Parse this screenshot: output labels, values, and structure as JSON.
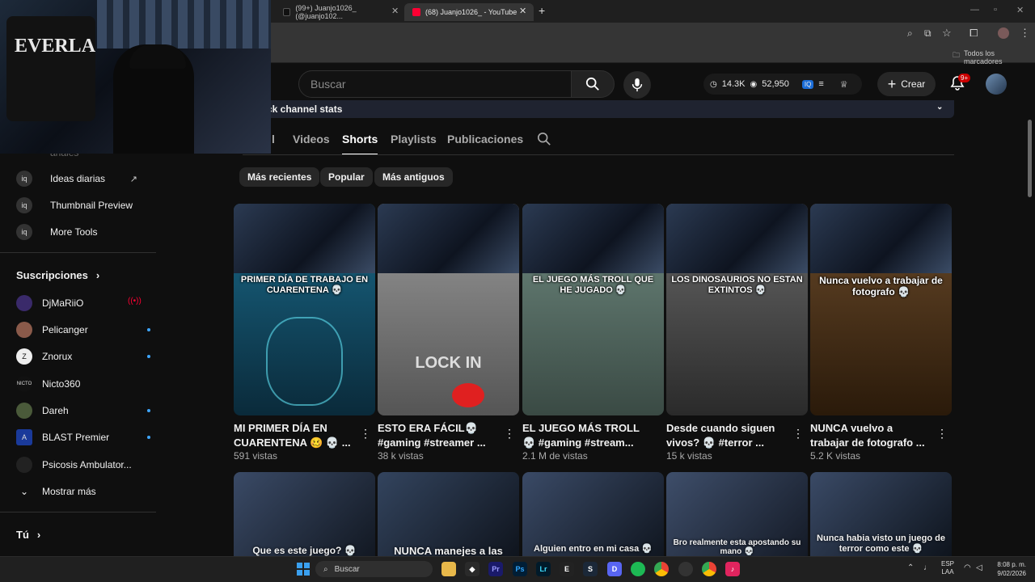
{
  "browser": {
    "tabs": [
      {
        "title": "(99+) Juanjo1026_ (@juanjo102..."
      },
      {
        "title": "(68) Juanjo1026_ - YouTube"
      }
    ],
    "bookmarks_label": "Todos los marcadores"
  },
  "header": {
    "search_placeholder": "Buscar",
    "subs_count": "14.3K",
    "views_count": "52,950",
    "create_label": "Crear",
    "notif_badge": "9+"
  },
  "channel_stats_label": "ck channel stats",
  "tabs": [
    {
      "label": "l"
    },
    {
      "label": "Videos"
    },
    {
      "label": "Shorts"
    },
    {
      "label": "Playlists"
    },
    {
      "label": "Publicaciones"
    }
  ],
  "chips": [
    "Más recientes",
    "Popular",
    "Más antiguos"
  ],
  "sidebar": {
    "partial_label": "anales",
    "tools": [
      {
        "label": "Ideas diarias"
      },
      {
        "label": "Thumbnail Preview"
      },
      {
        "label": "More Tools"
      }
    ],
    "subs_heading": "Suscripciones",
    "subs": [
      {
        "name": "DjMaRiiO",
        "live": true
      },
      {
        "name": "Pelicanger",
        "live": false
      },
      {
        "name": "Znorux",
        "live": false
      },
      {
        "name": "Nicto360",
        "live": false
      },
      {
        "name": "Dareh",
        "live": false
      },
      {
        "name": "BLAST Premier",
        "live": false
      },
      {
        "name": "Psicosis Ambulator...",
        "live": false
      }
    ],
    "show_more": "Mostrar más",
    "you_heading": "Tú"
  },
  "shorts_row1": [
    {
      "caption": "PRIMER DÍA DE TRABAJO EN CUARENTENA 💀",
      "title_l1": "MI PRIMER DÍA EN",
      "title_l2": "CUARENTENA 🥴 💀 ...",
      "views": "591 vistas"
    },
    {
      "caption": "LOCK IN",
      "title_l1": "ESTO ERA FÁCIL💀",
      "title_l2": "#gaming #streamer ...",
      "views": "38 k vistas"
    },
    {
      "caption": "EL JUEGO MÁS TROLL QUE HE JUGADO 💀",
      "title_l1": "EL JUEGO MÁS TROLL",
      "title_l2": "💀 #gaming #stream...",
      "views": "2.1 M de vistas"
    },
    {
      "caption": "LOS DINOSAURIOS NO ESTAN EXTINTOS 💀",
      "title_l1": "Desde cuando siguen",
      "title_l2": "vivos? 💀 #terror ...",
      "views": "15 k vistas"
    },
    {
      "caption": "Nunca vuelvo a trabajar de fotografo 💀",
      "title_l1": "NUNCA vuelvo a",
      "title_l2": "trabajar de fotografo ...",
      "views": "5.2 K vistas"
    }
  ],
  "shorts_row2": [
    {
      "caption": "Que es este juego? 💀"
    },
    {
      "caption": "NUNCA manejes a las"
    },
    {
      "caption": "Alguien entro en mi casa 💀"
    },
    {
      "caption": "Bro realmente esta apostando su mano 💀"
    },
    {
      "caption": "Nunca habia visto un juego de terror como este 💀"
    }
  ],
  "taskbar": {
    "search_label": "Buscar",
    "lang_l1": "ESP",
    "lang_l2": "LAA",
    "time": "8:08 p. m.",
    "date": "9/02/2026"
  },
  "colors": {
    "accent": "#3ea6ff",
    "live": "#ff0033",
    "bg": "#0f0f0f"
  }
}
